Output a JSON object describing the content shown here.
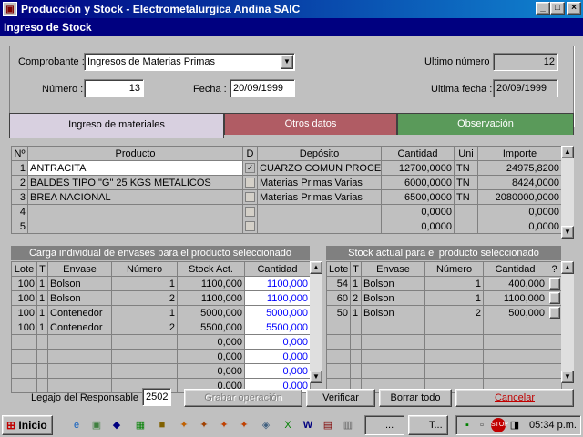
{
  "app": {
    "title": "Producción y Stock - Electrometalurgica Andina SAIC",
    "app_icon_glyph": "▣"
  },
  "window_controls": {
    "minimize": "_",
    "maximize": "□",
    "close": "×"
  },
  "form": {
    "title": "Ingreso de Stock"
  },
  "header": {
    "comprobante_label": "Comprobante :",
    "comprobante_value": "Ingresos de Materias Primas",
    "numero_label": "Número :",
    "numero_value": "13",
    "fecha_label": "Fecha :",
    "fecha_value": "20/09/1999",
    "ultimo_numero_label": "Ultimo número :",
    "ultimo_numero_value": "12",
    "ultima_fecha_label": "Ultima fecha :",
    "ultima_fecha_value": "20/09/1999"
  },
  "tabs": [
    {
      "label": "Ingreso de materiales",
      "color": "#d8d0e0"
    },
    {
      "label": "Otros datos",
      "color": "#b05c64"
    },
    {
      "label": "Observación",
      "color": "#5a9a5a"
    }
  ],
  "materials": {
    "columns": [
      "Nº",
      "Producto",
      "D",
      "Depósito",
      "Cantidad",
      "Uni",
      "Importe"
    ],
    "rows": [
      {
        "n": "1",
        "producto": "ANTRACITA",
        "d": true,
        "deposito": "CUARZO COMUN PROCES",
        "cantidad": "12700,0000",
        "uni": "TN",
        "importe": "24975,8200"
      },
      {
        "n": "2",
        "producto": "BALDES TIPO \"G\" 25 KGS METALICOS",
        "d": false,
        "deposito": "Materias Primas Varias",
        "cantidad": "6000,0000",
        "uni": "TN",
        "importe": "8424,0000"
      },
      {
        "n": "3",
        "producto": "BREA NACIONAL",
        "d": false,
        "deposito": "Materias Primas Varias",
        "cantidad": "6500,0000",
        "uni": "TN",
        "importe": "2080000,0000"
      },
      {
        "n": "4",
        "producto": "",
        "d": false,
        "deposito": "",
        "cantidad": "0,0000",
        "uni": "",
        "importe": "0,0000"
      },
      {
        "n": "5",
        "producto": "",
        "d": false,
        "deposito": "",
        "cantidad": "0,0000",
        "uni": "",
        "importe": "0,0000"
      }
    ]
  },
  "envases_panel": {
    "title": "Carga individual de envases para el producto seleccionado",
    "columns": [
      "Lote",
      "T",
      "Envase",
      "Número",
      "Stock Act.",
      "Cantidad"
    ],
    "rows": [
      {
        "lote": "100",
        "t": "1",
        "envase": "Bolson",
        "numero": "1",
        "stock": "1100,000",
        "cantidad": "1100,000"
      },
      {
        "lote": "100",
        "t": "1",
        "envase": "Bolson",
        "numero": "2",
        "stock": "1100,000",
        "cantidad": "1100,000"
      },
      {
        "lote": "100",
        "t": "1",
        "envase": "Contenedor",
        "numero": "1",
        "stock": "5000,000",
        "cantidad": "5000,000"
      },
      {
        "lote": "100",
        "t": "1",
        "envase": "Contenedor",
        "numero": "2",
        "stock": "5500,000",
        "cantidad": "5500,000"
      },
      {
        "lote": "",
        "t": "",
        "envase": "",
        "numero": "",
        "stock": "0,000",
        "cantidad": "0,000"
      },
      {
        "lote": "",
        "t": "",
        "envase": "",
        "numero": "",
        "stock": "0,000",
        "cantidad": "0,000"
      },
      {
        "lote": "",
        "t": "",
        "envase": "",
        "numero": "",
        "stock": "0,000",
        "cantidad": "0,000"
      },
      {
        "lote": "",
        "t": "",
        "envase": "",
        "numero": "",
        "stock": "0,000",
        "cantidad": "0,000"
      }
    ]
  },
  "stock_panel": {
    "title": "Stock actual para el producto seleccionado",
    "columns": [
      "Lote",
      "T",
      "Envase",
      "Número",
      "Cantidad",
      "?"
    ],
    "rows": [
      {
        "lote": "54",
        "t": "1",
        "envase": "Bolson",
        "numero": "1",
        "cantidad": "400,000"
      },
      {
        "lote": "60",
        "t": "2",
        "envase": "Bolson",
        "numero": "1",
        "cantidad": "1100,000"
      },
      {
        "lote": "50",
        "t": "1",
        "envase": "Bolson",
        "numero": "2",
        "cantidad": "500,000"
      },
      {
        "lote": "",
        "t": "",
        "envase": "",
        "numero": "",
        "cantidad": ""
      },
      {
        "lote": "",
        "t": "",
        "envase": "",
        "numero": "",
        "cantidad": ""
      },
      {
        "lote": "",
        "t": "",
        "envase": "",
        "numero": "",
        "cantidad": ""
      },
      {
        "lote": "",
        "t": "",
        "envase": "",
        "numero": "",
        "cantidad": ""
      },
      {
        "lote": "",
        "t": "",
        "envase": "",
        "numero": "",
        "cantidad": ""
      }
    ]
  },
  "footer": {
    "legajo_label": "Legajo del Responsable :",
    "legajo_value": "2502",
    "grabar": "Grabar operación",
    "verificar": "Verificar",
    "borrar": "Borrar todo",
    "cancelar": "Cancelar"
  },
  "taskbar": {
    "start_label": "Inicio",
    "task1": "...",
    "task2": "T...",
    "clock": "05:34 p.m."
  },
  "colors": {
    "title_blue": "#000080",
    "cancel_red": "#c00000",
    "value_blue": "#0000ff"
  }
}
